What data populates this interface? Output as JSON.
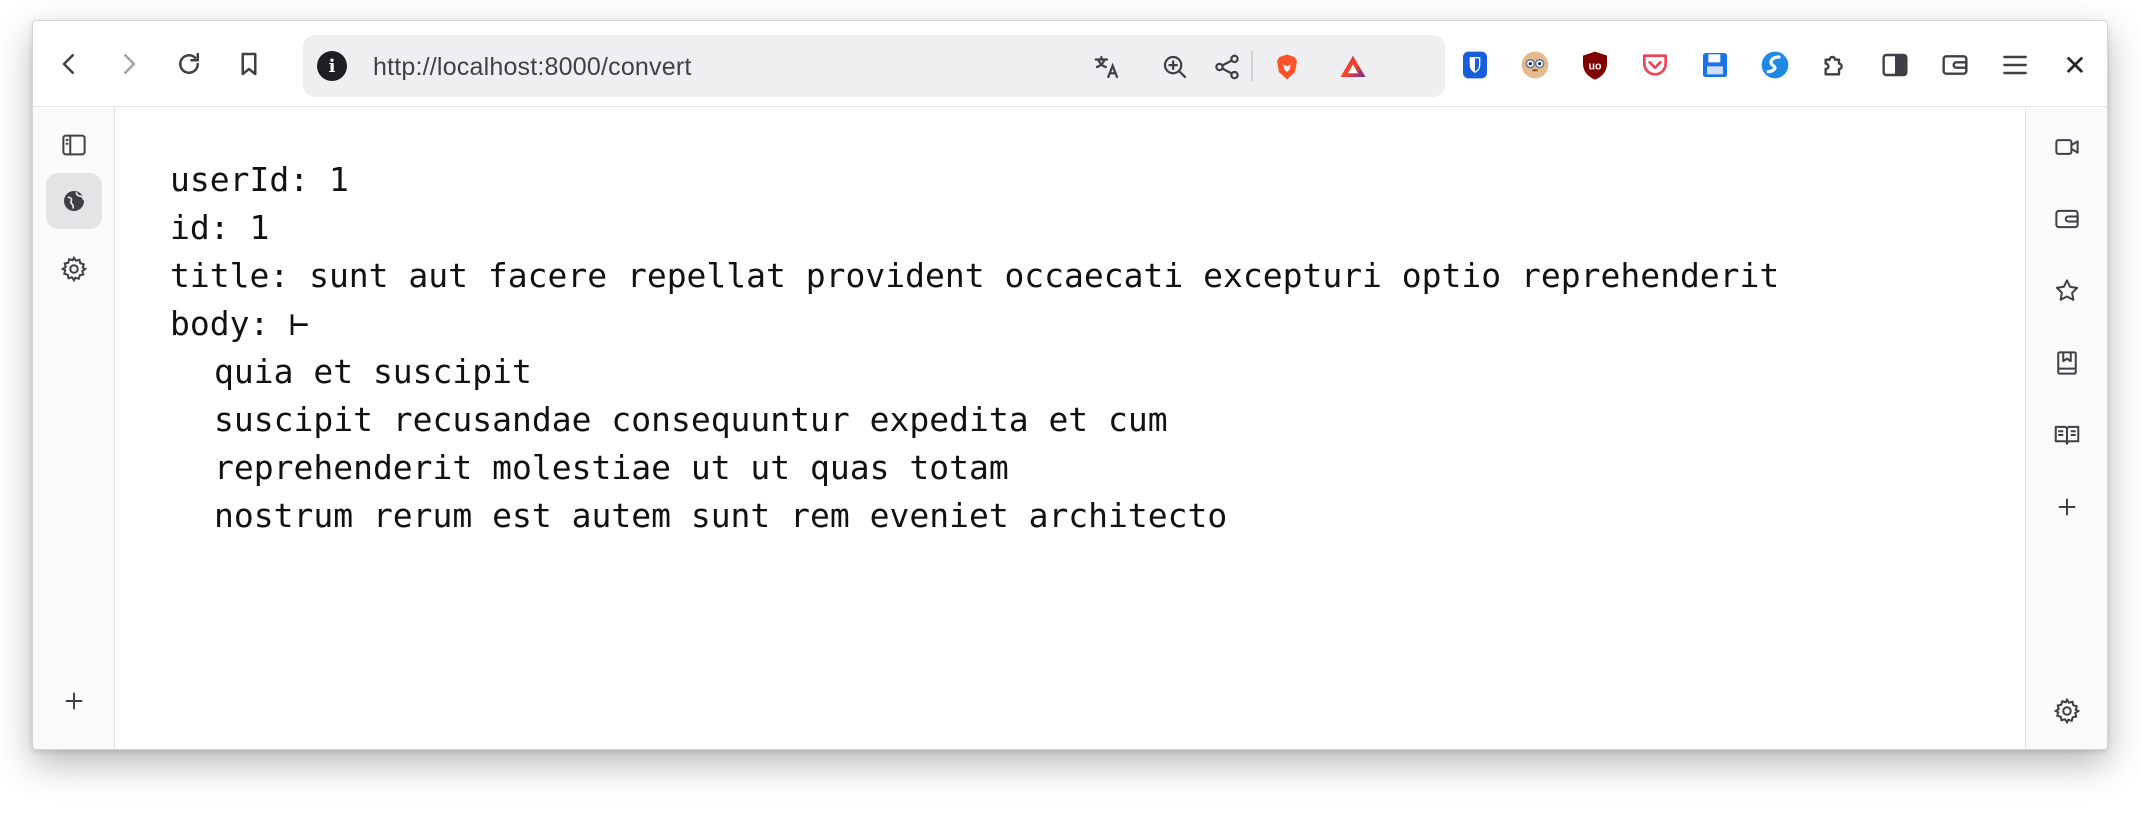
{
  "toolbar": {
    "url": "http://localhost:8000/convert",
    "info_glyph": "i",
    "close_glyph": "✕"
  },
  "content": {
    "lines": [
      "userId: 1",
      "id: 1",
      "title: sunt aut facere repellat provident occaecati excepturi optio reprehenderit",
      "body: ⊢"
    ],
    "body_lines": [
      "quia et suscipit",
      "suscipit recusandae consequuntur expedita et cum",
      "reprehenderit molestiae ut ut quas totam",
      "nostrum rerum est autem sunt rem eveniet architecto"
    ]
  },
  "colors": {
    "brave": "#fb542b",
    "bitwarden": "#175ddc",
    "ublock": "#800000",
    "pocket": "#ef4056",
    "save": "#1a73e8"
  }
}
